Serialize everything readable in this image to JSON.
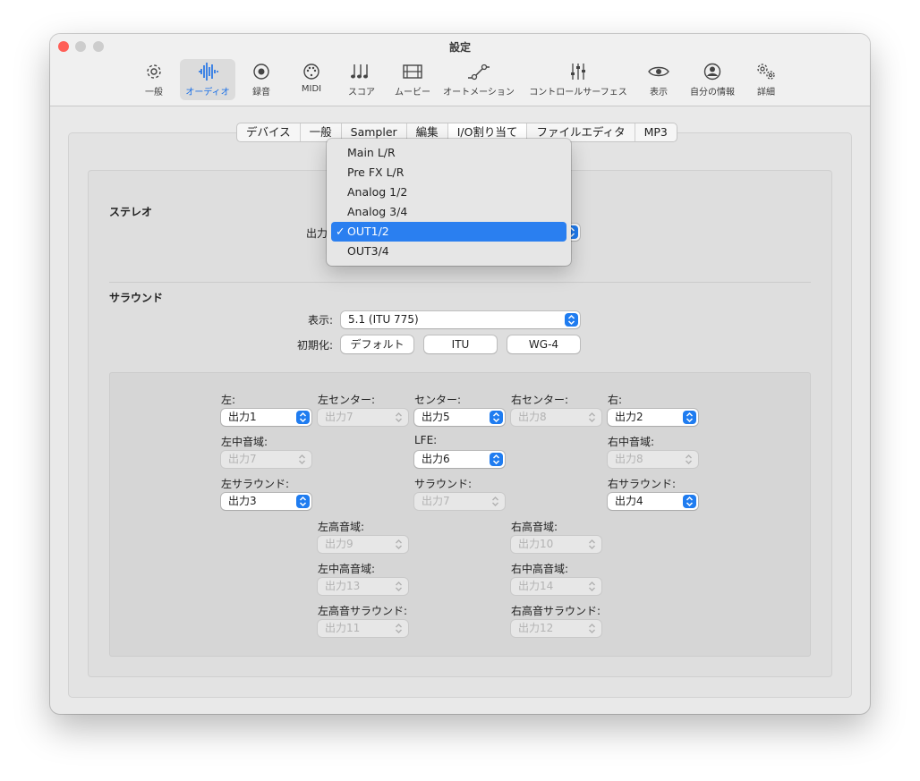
{
  "window": {
    "title": "設定"
  },
  "toolbar": {
    "items": [
      {
        "label": "一般",
        "icon": "gear-icon",
        "selected": false
      },
      {
        "label": "オーディオ",
        "icon": "waveform-icon",
        "selected": true
      },
      {
        "label": "録音",
        "icon": "record-icon",
        "selected": false
      },
      {
        "label": "MIDI",
        "icon": "midi-icon",
        "selected": false
      },
      {
        "label": "スコア",
        "icon": "music-notes-icon",
        "selected": false
      },
      {
        "label": "ムービー",
        "icon": "film-icon",
        "selected": false
      },
      {
        "label": "オートメーション",
        "icon": "automation-icon",
        "selected": false
      },
      {
        "label": "コントロールサーフェス",
        "icon": "faders-icon",
        "selected": false
      },
      {
        "label": "表示",
        "icon": "eye-icon",
        "selected": false
      },
      {
        "label": "自分の情報",
        "icon": "person-icon",
        "selected": false
      },
      {
        "label": "詳細",
        "icon": "gears-icon",
        "selected": false
      }
    ]
  },
  "tabs": [
    "デバイス",
    "一般",
    "Sampler",
    "編集",
    "I/O割り当て",
    "ファイルエディタ",
    "MP3"
  ],
  "selected_tab": "I/O割り当て",
  "stereo": {
    "section": "ステレオ",
    "output_label": "出力",
    "menu": {
      "items": [
        "Main L/R",
        "Pre FX L/R",
        "Analog 1/2",
        "Analog 3/4",
        "OUT1/2",
        "OUT3/4"
      ],
      "selected": "OUT1/2",
      "check": "✓"
    }
  },
  "surround": {
    "section": "サラウンド",
    "display_label": "表示:",
    "display_value": "5.1 (ITU 775)",
    "init_label": "初期化:",
    "init_buttons": [
      "デフォルト",
      "ITU",
      "WG-4"
    ],
    "channels": {
      "left": {
        "label": "左:",
        "value": "出力1",
        "enabled": true
      },
      "left_center": {
        "label": "左センター:",
        "value": "出力7",
        "enabled": false
      },
      "center": {
        "label": "センター:",
        "value": "出力5",
        "enabled": true
      },
      "right_center": {
        "label": "右センター:",
        "value": "出力8",
        "enabled": false
      },
      "right": {
        "label": "右:",
        "value": "出力2",
        "enabled": true
      },
      "left_mid": {
        "label": "左中音域:",
        "value": "出力7",
        "enabled": false
      },
      "lfe": {
        "label": "LFE:",
        "value": "出力6",
        "enabled": true
      },
      "right_mid": {
        "label": "右中音域:",
        "value": "出力8",
        "enabled": false
      },
      "left_surround": {
        "label": "左サラウンド:",
        "value": "出力3",
        "enabled": true
      },
      "surround": {
        "label": "サラウンド:",
        "value": "出力7",
        "enabled": false
      },
      "right_surround": {
        "label": "右サラウンド:",
        "value": "出力4",
        "enabled": true
      },
      "left_high": {
        "label": "左高音域:",
        "value": "出力9",
        "enabled": false
      },
      "right_high": {
        "label": "右高音域:",
        "value": "出力10",
        "enabled": false
      },
      "left_mid_high": {
        "label": "左中高音域:",
        "value": "出力13",
        "enabled": false
      },
      "right_mid_high": {
        "label": "右中高音域:",
        "value": "出力14",
        "enabled": false
      },
      "left_high_surround": {
        "label": "左高音サラウンド:",
        "value": "出力11",
        "enabled": false
      },
      "right_high_surround": {
        "label": "右高音サラウンド:",
        "value": "出力12",
        "enabled": false
      }
    }
  },
  "colors": {
    "accent": "#1f7cf0",
    "close": "#ff5f57",
    "traffic_inactive": "#c8c8c8"
  }
}
